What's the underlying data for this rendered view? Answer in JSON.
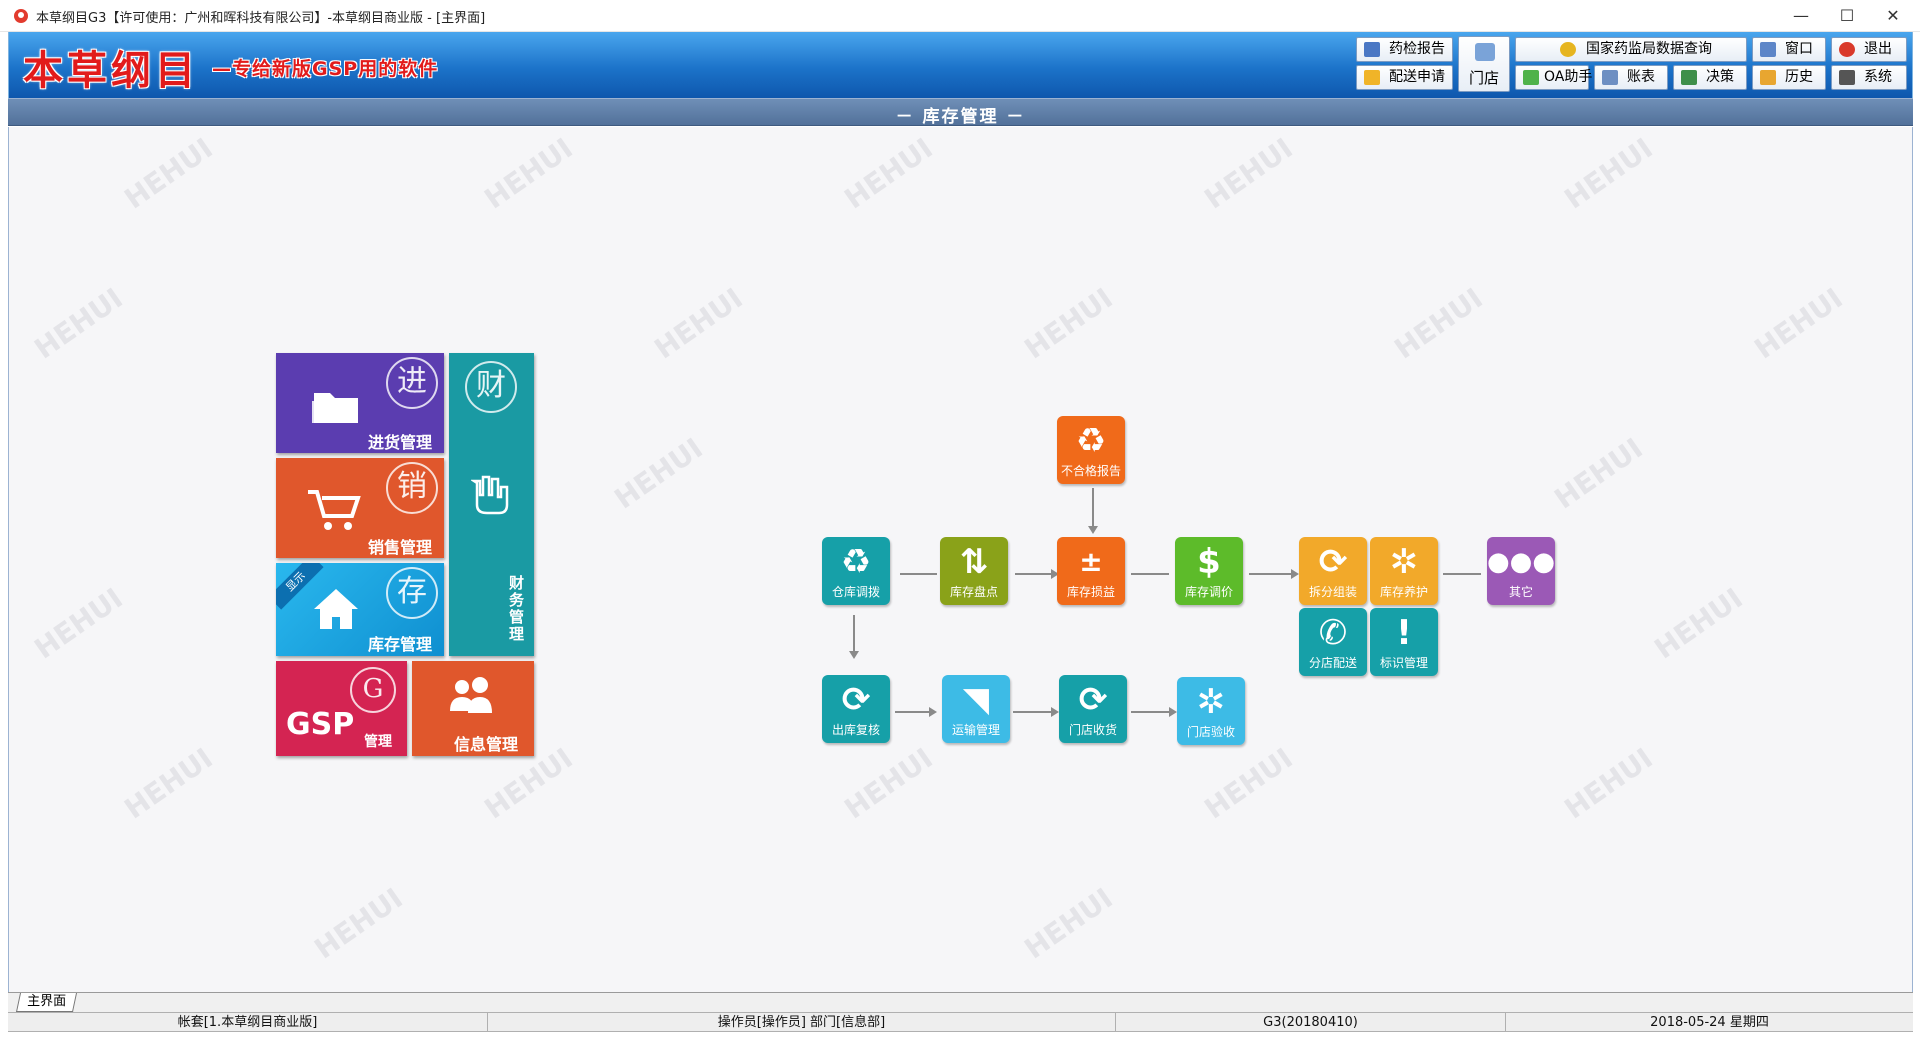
{
  "window": {
    "title": "本草纲目G3【许可使用：广州和晖科技有限公司】-本草纲目商业版 - [主界面]",
    "minimize": "—",
    "maximize": "☐",
    "close": "✕"
  },
  "banner": {
    "logo_main": "本草纲目",
    "logo_sub": "—专给新版GSP用的软件"
  },
  "toolbar": {
    "drug_inspection_report": "药检报告",
    "store": "门店",
    "nmpa_query": "国家药监局数据查询",
    "window": "窗口",
    "exit": "退出",
    "delivery_request": "配送申请",
    "oa_assistant": "OA助手",
    "ledger": "账表",
    "decision": "决策",
    "history": "历史",
    "system": "系统"
  },
  "section_title": "－ 库存管理 －",
  "watermark": "HEHUI",
  "modules": {
    "purchase": {
      "label": "进货管理",
      "char": "进"
    },
    "sales": {
      "label": "销售管理",
      "char": "销"
    },
    "inventory": {
      "label": "库存管理",
      "char": "存",
      "badge": "显示"
    },
    "finance": {
      "label": "财务管理",
      "char": "财"
    },
    "gsp": {
      "label": "管理",
      "logo": "GSP",
      "char": "G"
    },
    "info": {
      "label": "信息管理"
    }
  },
  "flow": {
    "nonconforming_report": "不合格报告",
    "warehouse_transfer": "仓库调拨",
    "stock_count": "库存盘点",
    "stock_profit_loss": "库存损益",
    "stock_price_adjust": "库存调价",
    "split_assemble": "拆分组装",
    "stock_maintenance": "库存养护",
    "other": "其它",
    "store_delivery": "分店配送",
    "label_management": "标识管理",
    "outbound_recheck": "出库复核",
    "transport_management": "运输管理",
    "store_receiving": "门店收货",
    "store_acceptance": "门店验收"
  },
  "colors": {
    "teal": "#16a0a8",
    "olive": "#8aa219",
    "orange": "#f08a1c",
    "green": "#5dbb2a",
    "amber": "#f2a92a",
    "purple": "#9b59b6",
    "sky": "#3dbbe6",
    "purchase": "#5b3db0",
    "sales": "#e0572c",
    "inventory": "#16a4e0",
    "finance": "#1a9aa3",
    "gsp": "#d42452",
    "info": "#e0572c"
  },
  "bottom_tab": "主界面",
  "status": {
    "account": "帐套[1.本草纲目商业版]",
    "operator": "操作员[操作员] 部门[信息部]",
    "version": "G3(20180410)",
    "date": "2018-05-24 星期四"
  }
}
